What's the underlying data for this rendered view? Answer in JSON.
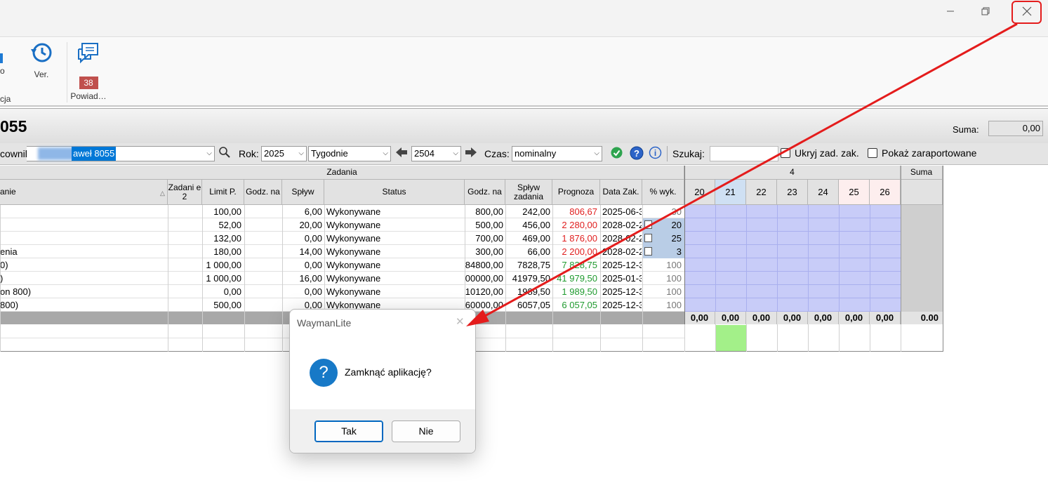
{
  "window": {
    "minimize_icon": "minimize-icon",
    "maximize_icon": "restore-icon",
    "close_icon": "close-icon"
  },
  "ribbon": {
    "partial_label": "o",
    "partial_group": "cja",
    "version_label": "Ver.",
    "notifications_label": "Powiad…",
    "notifications_count": "38"
  },
  "header": {
    "title": "055",
    "suma_label": "Suma:",
    "suma_value": "0,00"
  },
  "toolbar": {
    "worker_label": "cownil",
    "worker_value": "aweł 8055",
    "year_label": "Rok:",
    "year_value": "2025",
    "period_value": "Tygodnie",
    "week_value": "2504",
    "time_label": "Czas:",
    "time_value": "nominalny",
    "search_label": "Szukaj:",
    "search_value": "",
    "hide_completed_label": "Ukryj zad. zak.",
    "show_reported_label": "Pokaż zaraportowane"
  },
  "grid": {
    "group_header": "Zadania",
    "week_header": "4",
    "sum_header": "Suma",
    "columns": [
      "anie",
      "Zadani e 2",
      "Limit P.",
      "Godz. na",
      "Spływ",
      "Status",
      "Godz. na",
      "Spływ zadania",
      "Prognoza",
      "Data Zak.",
      "% wyk."
    ],
    "days": [
      "20",
      "21",
      "22",
      "23",
      "24",
      "25",
      "26"
    ],
    "rows": [
      {
        "name": "",
        "limit": "100,00",
        "godz": "",
        "splyw": "6,00",
        "status": "Wykonywane",
        "godz2": "800,00",
        "splyw2": "242,00",
        "prognoza": "806,67",
        "pcolor": "red",
        "data": "2025-06-3",
        "pct": "30",
        "pctgray": true,
        "cal": false
      },
      {
        "name": "",
        "limit": "52,00",
        "godz": "",
        "splyw": "20,00",
        "status": "Wykonywane",
        "godz2": "500,00",
        "splyw2": "456,00",
        "prognoza": "2 280,00",
        "pcolor": "red",
        "data": "2028-02-2",
        "pct": "20",
        "pctgray": false,
        "cal": true
      },
      {
        "name": "",
        "limit": "132,00",
        "godz": "",
        "splyw": "0,00",
        "status": "Wykonywane",
        "godz2": "700,00",
        "splyw2": "469,00",
        "prognoza": "1 876,00",
        "pcolor": "red",
        "data": "2028-02-2",
        "pct": "25",
        "pctgray": false,
        "cal": true
      },
      {
        "name": "enia",
        "limit": "180,00",
        "godz": "",
        "splyw": "14,00",
        "status": "Wykonywane",
        "godz2": "300,00",
        "splyw2": "66,00",
        "prognoza": "2 200,00",
        "pcolor": "red",
        "data": "2028-02-2",
        "pct": "3",
        "pctgray": false,
        "cal": true
      },
      {
        "name": "0)",
        "limit": "1 000,00",
        "godz": "",
        "splyw": "0,00",
        "status": "Wykonywane",
        "godz2": "84800,00",
        "splyw2": "7828,75",
        "prognoza": "7 828,75",
        "pcolor": "green",
        "data": "2025-12-3",
        "pct": "100",
        "pctgray": true,
        "cal": false
      },
      {
        "name": ")",
        "limit": "1 000,00",
        "godz": "",
        "splyw": "16,00",
        "status": "Wykonywane",
        "godz2": "00000,00",
        "splyw2": "41979,50",
        "prognoza": "41 979,50",
        "pcolor": "green",
        "data": "2025-01-3",
        "pct": "100",
        "pctgray": true,
        "cal": false
      },
      {
        "name": "on 800)",
        "limit": "0,00",
        "godz": "",
        "splyw": "0,00",
        "status": "Wykonywane",
        "godz2": "10120,00",
        "splyw2": "1989,50",
        "prognoza": "1 989,50",
        "pcolor": "green",
        "data": "2025-12-3",
        "pct": "100",
        "pctgray": true,
        "cal": false
      },
      {
        "name": "800)",
        "limit": "500,00",
        "godz": "",
        "splyw": "0,00",
        "status": "Wykonywane",
        "godz2": "60000,00",
        "splyw2": "6057,05",
        "prognoza": "6 057,05",
        "pcolor": "green",
        "data": "2025-12-3",
        "pct": "100",
        "pctgray": true,
        "cal": false
      }
    ],
    "totals": [
      "0,00",
      "0,00",
      "0,00",
      "0,00",
      "0,00",
      "0,00",
      "0,00"
    ],
    "total_sum": "0.00"
  },
  "dialog": {
    "title": "WaymanLite",
    "message": "Zamknąć aplikację?",
    "yes_label": "Tak",
    "no_label": "Nie",
    "icon": "question-icon"
  },
  "colors": {
    "day_fill": "#c8ccf8",
    "weekend_header": "#fdeeee",
    "today_header": "#cfe0f3",
    "today_mark": "#a3f089",
    "arrow": "#e41c1c"
  }
}
